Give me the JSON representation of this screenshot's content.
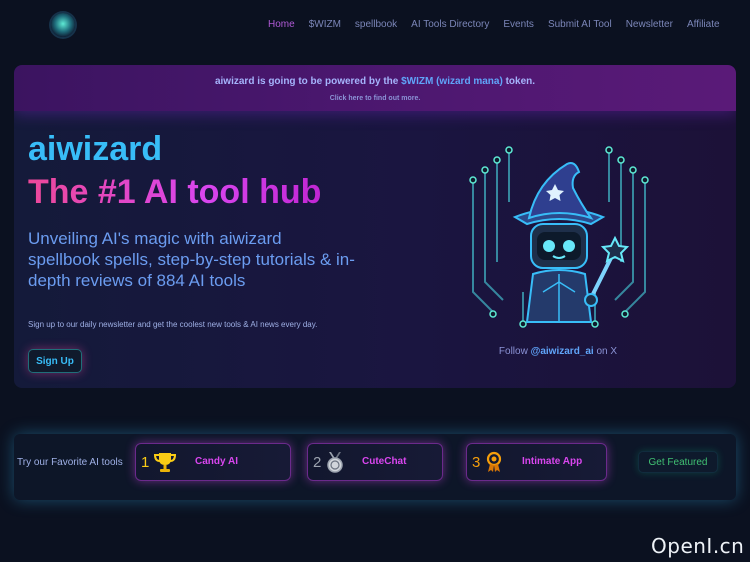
{
  "header": {
    "logo_icon": "wizard-robot-logo-icon",
    "nav": [
      {
        "label": "Home",
        "active": true
      },
      {
        "label": "$WIZM",
        "active": false
      },
      {
        "label": "spellbook",
        "active": false
      },
      {
        "label": "AI Tools Directory",
        "active": false
      },
      {
        "label": "Events",
        "active": false
      },
      {
        "label": "Submit AI Tool",
        "active": false
      },
      {
        "label": "Newsletter",
        "active": false
      },
      {
        "label": "Affiliate",
        "active": false
      }
    ]
  },
  "banner": {
    "part1": "aiwizard is going to be powered by the ",
    "highlight": "$WIZM (wizard mana)",
    "part2": " token.",
    "sub": "Click here to find out more."
  },
  "hero": {
    "title": "aiwizard",
    "subtitle": "The #1 AI tool hub",
    "description": "Unveiling AI's magic with aiwizard spellbook spells, step-by-step tutorials & in-depth reviews of 884 AI tools",
    "newsletter_note": "Sign up to our daily newsletter and get the coolest new tools & AI news every day.",
    "signup_label": "Sign Up",
    "image_icon": "wizard-robot-icon",
    "follow_prefix": "Follow ",
    "follow_handle": "@aiwizard_ai",
    "follow_suffix": " on X"
  },
  "favorites": {
    "label": "Try our Favorite AI tools",
    "tools": [
      {
        "rank": "1",
        "name": "Candy AI",
        "icon": "trophy-icon",
        "rank_color": "#facc15"
      },
      {
        "rank": "2",
        "name": "CuteChat",
        "icon": "silver-medal-icon",
        "rank_color": "#9ca3af"
      },
      {
        "rank": "3",
        "name": "Intimate App",
        "icon": "bronze-award-icon",
        "rank_color": "#f59e0b"
      }
    ],
    "get_featured_label": "Get Featured"
  },
  "watermark": "OpenI.cn",
  "colors": {
    "background": "#0b1120",
    "accent_cyan": "#38bdf8",
    "accent_magenta": "#d946ef",
    "nav_active": "#b05ad6"
  }
}
